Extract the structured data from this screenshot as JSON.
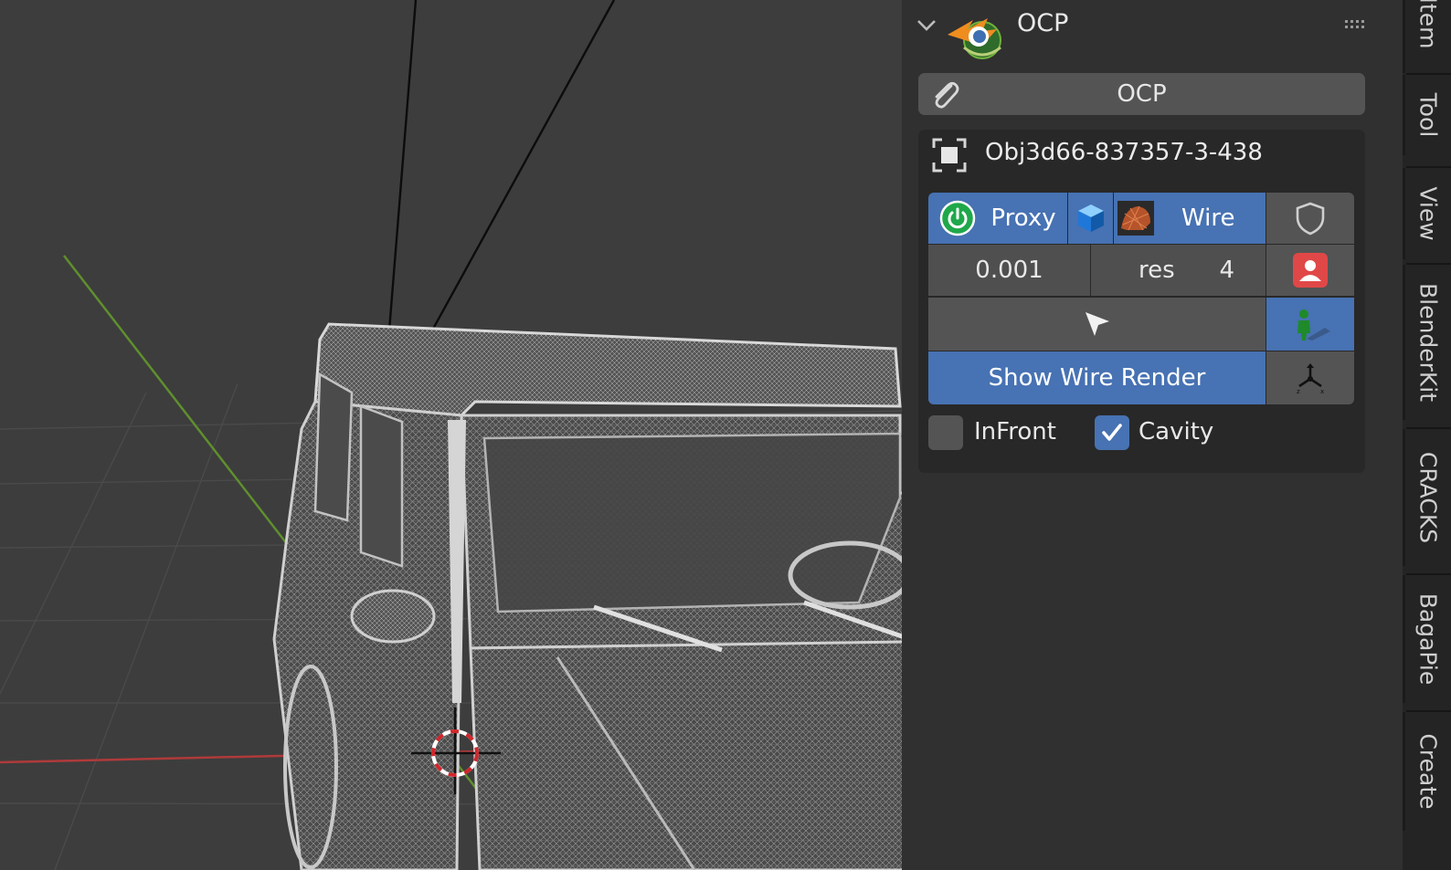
{
  "viewport": {
    "object_description": "wireframe off-road vehicle"
  },
  "panel": {
    "title": "OCP",
    "main_button_label": "OCP",
    "object_name": "Obj3d66-837357-3-438",
    "proxy_label": "Proxy",
    "wire_label": "Wire",
    "threshold_value": "0.001",
    "res_label": "res",
    "res_value": "4",
    "show_wire_render_label": "Show Wire Render",
    "infront_label": "InFront",
    "infront_checked": false,
    "cavity_label": "Cavity",
    "cavity_checked": true,
    "icons": [
      "collapse-chevron-icon",
      "ocp-addon-logo-icon",
      "drag-grip-icon",
      "paperclip-icon",
      "object-frame-icon",
      "power-icon",
      "cube-icon",
      "wire-mesh-thumbnail-icon",
      "shield-icon",
      "user-icon",
      "cursor-icon",
      "figure-icon",
      "axes-icon",
      "checkmark-icon"
    ]
  },
  "tabs": [
    {
      "label": "Item"
    },
    {
      "label": "Tool"
    },
    {
      "label": "View"
    },
    {
      "label": "BlenderKit"
    },
    {
      "label": "CRACKS"
    },
    {
      "label": "BagaPie"
    },
    {
      "label": "Create"
    }
  ],
  "colors": {
    "accent": "#4772b3",
    "panel_bg": "#303030",
    "button_bg": "#545454",
    "viewport_bg": "#3d3d3d",
    "x_axis": "#b03a3a",
    "y_axis": "#5f8f2e",
    "user_icon_red": "#e04848",
    "power_green": "#1fa84a"
  }
}
